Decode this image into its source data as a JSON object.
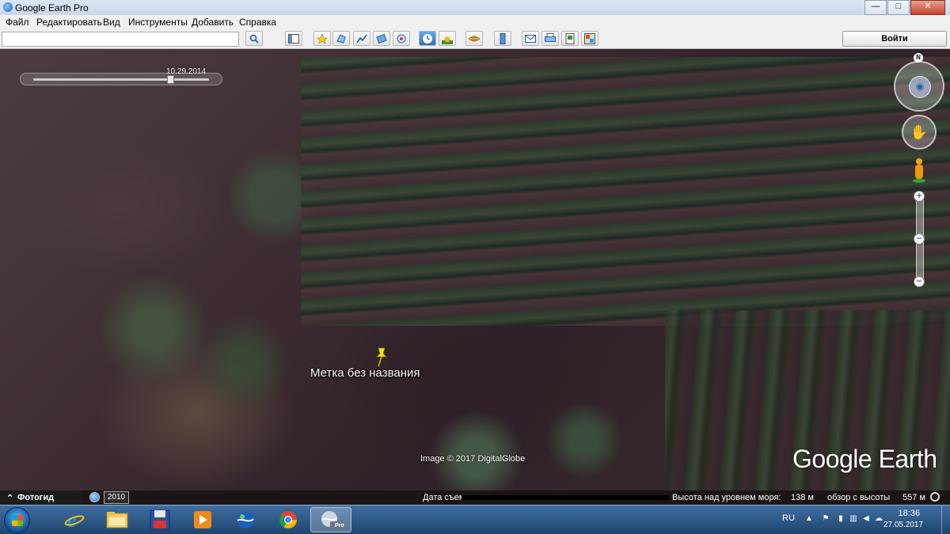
{
  "window": {
    "title": "Google Earth Pro",
    "minimize": "—",
    "maximize": "□",
    "close": "✕"
  },
  "menu": [
    "Файл",
    "Редактировать",
    "Вид",
    "Инструменты",
    "Добавить",
    "Справка"
  ],
  "toolbar": {
    "search_value": "",
    "login_label": "Войти",
    "icons": [
      "search-icon",
      "sidebar-icon",
      "placemark-icon",
      "polygon-icon",
      "path-icon",
      "overlay-icon",
      "tour-icon",
      "historical-imagery-icon",
      "sunlight-icon",
      "planets-icon",
      "ruler-icon",
      "email-icon",
      "print-icon",
      "save-image-icon",
      "maps-icon"
    ]
  },
  "map": {
    "time_slider_date": "10.29.2014",
    "time_slider_position": 0.78,
    "compass_north": "N",
    "placemark_label": "Метка без названия",
    "imagery_credit": "Image © 2017 DigitalGlobe",
    "logo_text": "Google Earth"
  },
  "statusbar": {
    "tour_guide": "Фотогид",
    "tour_guide_chevron": "⌃",
    "historical_year": "2010",
    "imagery_date_label": "Дата съем",
    "elevation_label": "Высота над уровнем моря:",
    "elevation_value": "138 м",
    "eye_alt_label": "обзор с высоты",
    "eye_alt_value": "557 м"
  },
  "taskbar": {
    "apps": [
      "internet-explorer",
      "file-explorer",
      "save-app",
      "media-player",
      "google-earth-old",
      "chrome",
      "google-earth-pro"
    ],
    "active_app": "google-earth-pro",
    "google_earth_badge": "Pro",
    "lang": "RU",
    "time": "18:36",
    "date": "27.05.2017"
  },
  "colors": {
    "titlebar": "#c9d8ea",
    "toolbar_bg": "#f0f0f0",
    "taskbar": "#1e4570",
    "placemark": "#f5e21a",
    "active_button": "#2f6fbf"
  }
}
